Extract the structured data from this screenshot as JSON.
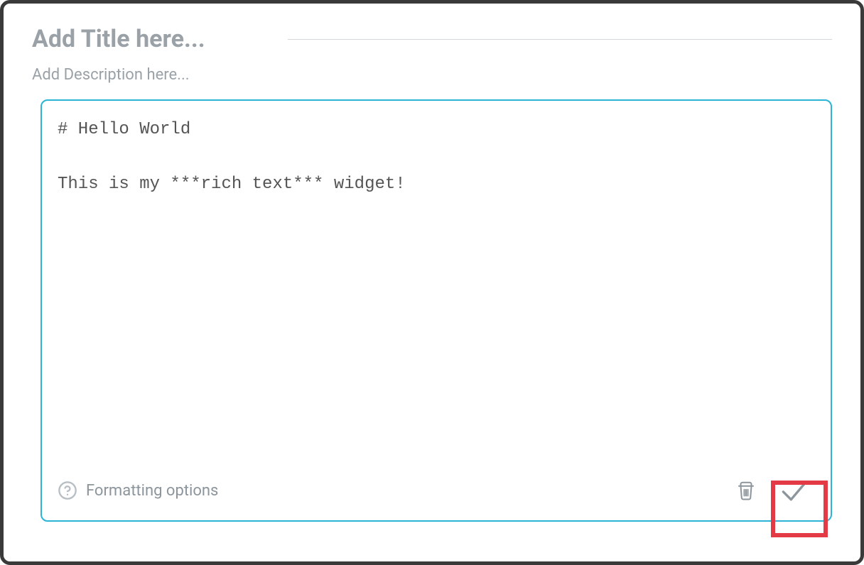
{
  "title": {
    "value": "",
    "placeholder": "Add Title here..."
  },
  "description": {
    "value": "",
    "placeholder": "Add Description here..."
  },
  "editor": {
    "content": "# Hello World\n\nThis is my ***rich text*** widget!"
  },
  "footer": {
    "formatting_label": "Formatting options"
  },
  "icons": {
    "help": "help-circle-icon",
    "trash": "trash-icon",
    "confirm": "check-icon"
  }
}
